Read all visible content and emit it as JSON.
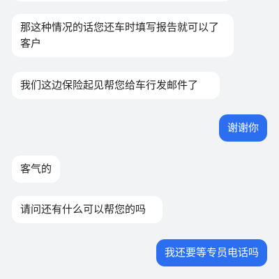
{
  "messages": [
    {
      "side": "incoming",
      "text": "那这种情况的话您还车时填写报告就可以了客户"
    },
    {
      "side": "incoming",
      "text": "我们这边保险起见帮您给车行发邮件了"
    },
    {
      "side": "outgoing",
      "text": "谢谢你"
    },
    {
      "side": "incoming",
      "text": "客气的"
    },
    {
      "side": "incoming",
      "text": "请问还有什么可以帮您的吗"
    },
    {
      "side": "outgoing",
      "text": "我还要等专员电话吗"
    }
  ],
  "colors": {
    "background": "#f2f3f5",
    "incoming_bubble": "#ffffff",
    "outgoing_bubble": "#2b6ff0",
    "outgoing_text": "#ffffff",
    "incoming_text": "#1f1f1f"
  }
}
